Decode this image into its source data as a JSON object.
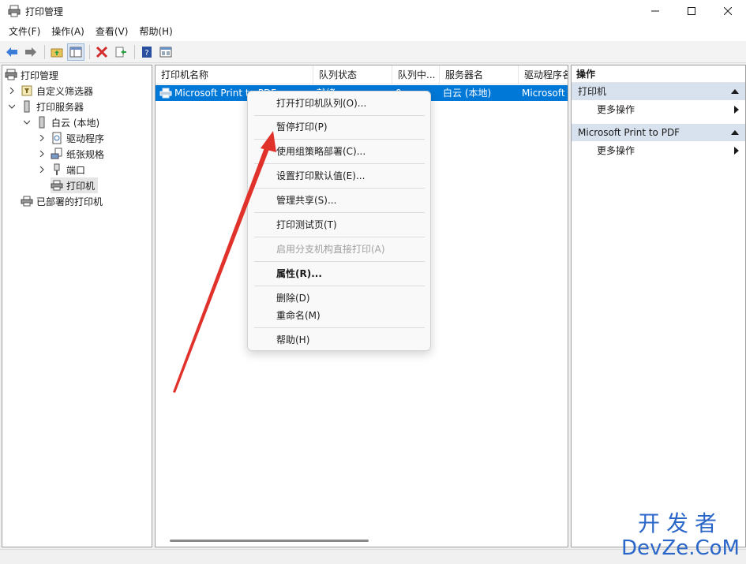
{
  "window": {
    "title": "打印管理"
  },
  "menubar": [
    "文件(F)",
    "操作(A)",
    "查看(V)",
    "帮助(H)"
  ],
  "toolbar": {
    "icons": [
      "back-arrow-icon",
      "forward-arrow-icon",
      "up-folder-icon",
      "show-hide-tree-icon",
      "delete-icon",
      "export-icon",
      "help-icon",
      "view-icon"
    ]
  },
  "tree": {
    "root": "打印管理",
    "custom_filters": "自定义筛选器",
    "print_servers": "打印服务器",
    "local_server": "白云 (本地)",
    "drivers": "驱动程序",
    "forms": "纸张规格",
    "ports": "端口",
    "printers": "打印机",
    "deployed": "已部署的打印机"
  },
  "list": {
    "columns": [
      "打印机名称",
      "队列状态",
      "队列中...",
      "服务器名",
      "驱动程序名"
    ],
    "row": {
      "name": "Microsoft Print to PDF",
      "status": "就绪",
      "jobs": "0",
      "server": "白云 (本地)",
      "driver": "Microsoft"
    }
  },
  "actions": {
    "title": "操作",
    "sections": [
      {
        "name": "打印机",
        "item": "更多操作"
      },
      {
        "name": "Microsoft Print to PDF",
        "item": "更多操作"
      }
    ]
  },
  "context_menu": [
    {
      "label": "打开打印机队列(O)...",
      "enabled": true
    },
    {
      "label": "暂停打印(P)",
      "enabled": true
    },
    {
      "label": "使用组策略部署(C)...",
      "enabled": true
    },
    {
      "label": "设置打印默认值(E)...",
      "enabled": true
    },
    {
      "label": "管理共享(S)...",
      "enabled": true
    },
    {
      "label": "打印测试页(T)",
      "enabled": true
    },
    {
      "label": "启用分支机构直接打印(A)",
      "enabled": false
    },
    {
      "label": "属性(R)...",
      "enabled": true
    },
    {
      "label": "删除(D)",
      "enabled": true
    },
    {
      "label": "重命名(M)",
      "enabled": true
    },
    {
      "label": "帮助(H)",
      "enabled": true
    }
  ],
  "watermark": {
    "cn": "开发者",
    "en": "DevZe.CoM"
  },
  "colors": {
    "selection": "#0078d7",
    "annotation_arrow": "#e0312b",
    "watermark": "#2b67c8"
  }
}
